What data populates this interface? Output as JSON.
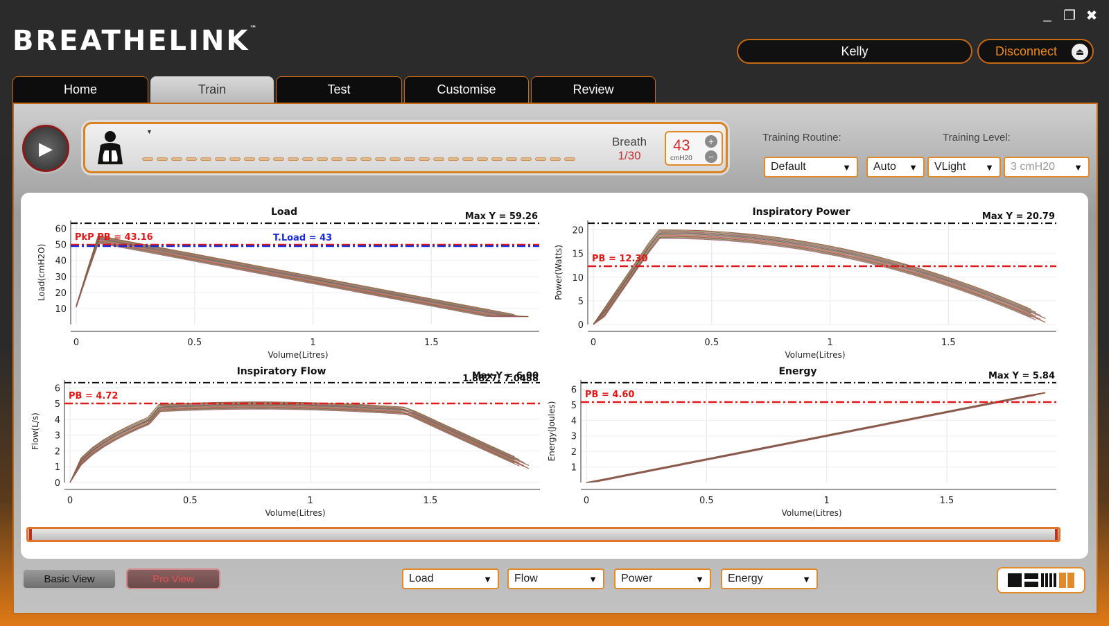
{
  "window": {
    "minimize_icon": "minimize-icon",
    "restore_icon": "restore-icon",
    "close_icon": "close-icon"
  },
  "brand": {
    "logo_text": "BREATHELINK",
    "trademark": "™"
  },
  "user": {
    "name": "Kelly",
    "disconnect_label": "Disconnect"
  },
  "tabs": [
    {
      "label": "Home",
      "active": false
    },
    {
      "label": "Train",
      "active": true
    },
    {
      "label": "Test",
      "active": false
    },
    {
      "label": "Customise",
      "active": false
    },
    {
      "label": "Review",
      "active": false
    }
  ],
  "session": {
    "breath_label": "Breath",
    "breath_count": "1/30",
    "load_value": "43",
    "load_unit": "cmH20",
    "plus": "+",
    "minus": "−"
  },
  "training": {
    "routine_label": "Training Routine:",
    "level_label": "Training Level:",
    "routine_value": "Default",
    "mode_value": "Auto",
    "level_value": "VLight",
    "pressure_value": "3 cmH20"
  },
  "charts": [
    {
      "title": "Load",
      "xlabel": "Volume(Litres)",
      "ylabel": "Load(cmH2O)",
      "max_label": "Max Y = 59.26",
      "pb_label": "PkP PB = 43.16",
      "extra_label": "T.Load = 43",
      "yticks": [
        "10",
        "20",
        "30",
        "40",
        "50",
        "60"
      ],
      "xticks": [
        "0",
        "0.5",
        "1",
        "1.5"
      ]
    },
    {
      "title": "Inspiratory Power",
      "xlabel": "Volume(Litres)",
      "ylabel": "Power(Watts)",
      "max_label": "Max Y = 20.79",
      "pb_label": "PB = 12.30",
      "yticks": [
        "0",
        "5",
        "10",
        "15",
        "20"
      ],
      "xticks": [
        "0",
        "0.5",
        "1",
        "1.5"
      ]
    },
    {
      "title": "Inspiratory Flow",
      "xlabel": "Volume(Litres)",
      "ylabel": "Flow(L/s)",
      "max_label": "Max Y = 6.00",
      "overlap_label": "1.8827, 7.0488",
      "pb_label": "PB = 4.72",
      "yticks": [
        "0",
        "1",
        "2",
        "3",
        "4",
        "5",
        "6"
      ],
      "xticks": [
        "0",
        "0.5",
        "1",
        "1.5"
      ]
    },
    {
      "title": "Energy",
      "xlabel": "Volume(Litres)",
      "ylabel": "Energy(Joules)",
      "max_label": "Max Y = 5.84",
      "pb_label": "PB = 4.60",
      "yticks": [
        "1",
        "2",
        "3",
        "4",
        "5",
        "6"
      ],
      "xticks": [
        "0",
        "0.5",
        "1",
        "1.5"
      ]
    }
  ],
  "view": {
    "basic_label": "Basic View",
    "pro_label": "Pro View"
  },
  "bottom_selects": [
    "Load",
    "Flow",
    "Power",
    "Energy"
  ],
  "colors": {
    "accent": "#e0821f",
    "pb_red": "#e01818",
    "target_blue": "#1a2ad8",
    "max_black": "#111111"
  }
}
